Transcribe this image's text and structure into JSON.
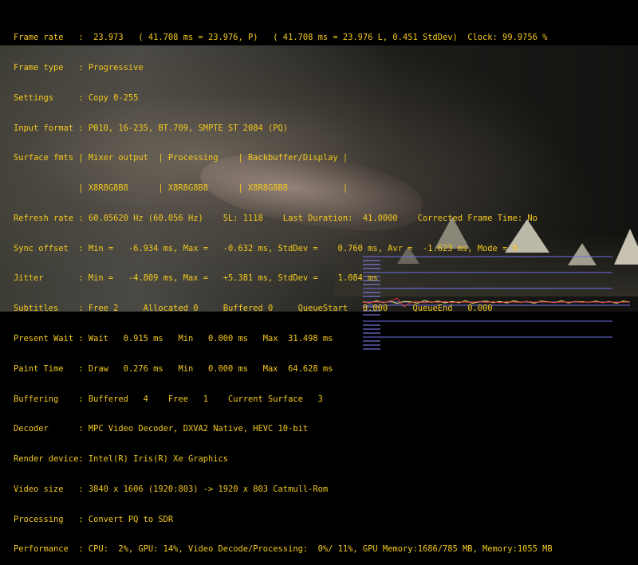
{
  "osd": {
    "lines": [
      "Frame rate   :  23.973   ( 41.708 ms = 23.976, P)   ( 41.708 ms = 23.976 L, 0.451 StdDev)  Clock: 99.9756 %",
      "Frame type   : Progressive",
      "Settings     : Copy 0-255",
      "Input format : P010, 16-235, BT.709, SMPTE ST 2084 (PQ)",
      "Surface fmts | Mixer output  | Processing    | Backbuffer/Display |",
      "             | X8R8G8B8      | X8R8G8B8      | X8R8G8B8           |",
      "Refresh rate : 60.05620 Hz (60.056 Hz)    SL: 1118    Last Duration:  41.0000    Corrected Frame Time: No",
      "Sync offset  : Min =   -6.934 ms, Max =   -0.632 ms, StdDev =    0.760 ms, Avr =  -1.623 ms, Mode = 0",
      "Jitter       : Min =   -4.809 ms, Max =   +5.381 ms, StdDev =    1.084 ms",
      "Subtitles    : Free 2     Allocated 0     Buffered 0     QueueStart   0.000     QueueEnd   0.000",
      "Present Wait : Wait   0.915 ms   Min   0.000 ms   Max  31.498 ms",
      "Paint Time   : Draw   0.276 ms   Min   0.000 ms   Max  64.628 ms",
      "Buffering    : Buffered   4    Free   1    Current Surface   3",
      "Decoder      : MPC Video Decoder, DXVA2 Native, HEVC 10-bit",
      "Render device: Intel(R) Iris(R) Xe Graphics",
      "Video size   : 3840 x 1606 (1920:803) -> 1920 x 803 Catmull-Rom",
      "Processing   : Convert PQ to SDR",
      "Performance  : CPU:  2%, GPU: 14%, Video Decode/Processing:  0%/ 11%, GPU Memory:1686/785 MB, Memory:1055 MB"
    ]
  },
  "colors": {
    "osd_text": "#f3c91e",
    "graph_grid": "#6f6fe8",
    "graph_short_ticks": "#8c8cff",
    "jitter_line": "#e0e060",
    "sync_line": "#e04040",
    "baseline": "#40c040"
  },
  "jitter_graph": {
    "jitter_series": [
      0.1,
      -0.3,
      0.4,
      -0.2,
      0.3,
      -0.5,
      0.2,
      0.1,
      -0.4,
      0.5,
      -0.1,
      0.3,
      -0.3,
      0.2,
      -0.2,
      0.4,
      -0.4,
      0.1,
      0.3,
      -0.2,
      0.2,
      -0.3,
      0.4,
      -0.1,
      0.2,
      -0.4,
      0.3,
      0.1,
      -0.2,
      0.4,
      -0.3,
      0.2,
      0.1,
      -0.1,
      0.3,
      -0.2,
      0.2,
      -0.4,
      0.3,
      0.0
    ],
    "sync_series": [
      -0.1,
      -0.2,
      0.1,
      -0.1,
      0.2,
      1.2,
      -1.5,
      -0.1,
      0.1,
      -0.2,
      0.1,
      -0.1,
      0.2,
      -0.2,
      0.1,
      0.0,
      -0.1,
      0.2,
      -0.1,
      0.1,
      -0.2,
      0.1,
      0.0,
      -0.1,
      0.2,
      -0.1,
      0.1,
      0.0,
      -0.2,
      0.1,
      -0.1,
      0.2,
      -0.1,
      0.0,
      0.1,
      -0.2,
      0.1,
      -0.1,
      0.0,
      0.1
    ]
  }
}
